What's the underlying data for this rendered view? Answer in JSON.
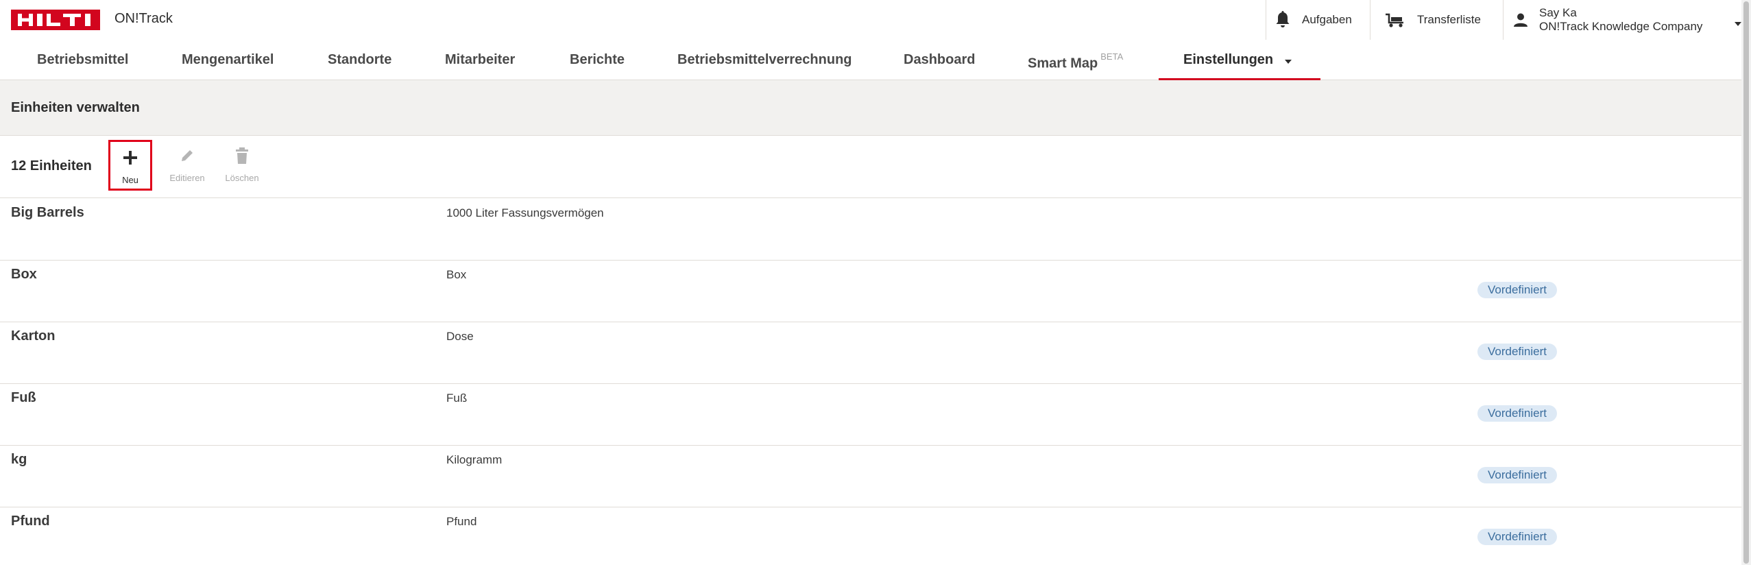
{
  "header": {
    "brand": "HILTI",
    "app_name": "ON!Track",
    "actions": {
      "aufgaben": "Aufgaben",
      "transferliste": "Transferliste"
    },
    "user": {
      "name": "Say Ka",
      "company": "ON!Track Knowledge Company"
    }
  },
  "nav": {
    "items": [
      {
        "label": "Betriebsmittel"
      },
      {
        "label": "Mengenartikel"
      },
      {
        "label": "Standorte"
      },
      {
        "label": "Mitarbeiter"
      },
      {
        "label": "Berichte"
      },
      {
        "label": "Betriebsmittelverrechnung"
      },
      {
        "label": "Dashboard"
      },
      {
        "label": "Smart Map",
        "badge": "BETA"
      },
      {
        "label": "Einstellungen"
      }
    ],
    "active": "Einstellungen"
  },
  "section": {
    "title": "Einheiten verwalten"
  },
  "toolbar": {
    "count_label": "12 Einheiten",
    "new_label": "Neu",
    "edit_label": "Editieren",
    "delete_label": "Löschen"
  },
  "units": [
    {
      "name": "Big Barrels",
      "description": "1000 Liter Fassungsvermögen",
      "badge": ""
    },
    {
      "name": "Box",
      "description": "Box",
      "badge": "Vordefiniert"
    },
    {
      "name": "Karton",
      "description": "Dose",
      "badge": "Vordefiniert"
    },
    {
      "name": "Fuß",
      "description": "Fuß",
      "badge": "Vordefiniert"
    },
    {
      "name": "kg",
      "description": "Kilogramm",
      "badge": "Vordefiniert"
    },
    {
      "name": "Pfund",
      "description": "Pfund",
      "badge": "Vordefiniert"
    }
  ],
  "colors": {
    "brand_red": "#d2051e",
    "highlight_border": "#e0001a",
    "badge_bg": "#dde9f5",
    "badge_text": "#3c6e9e"
  }
}
